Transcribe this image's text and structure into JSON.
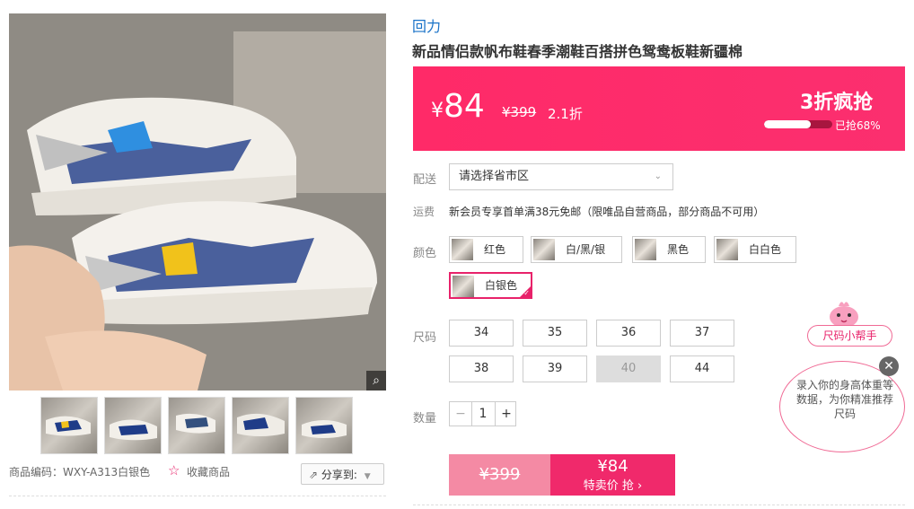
{
  "gallery": {
    "zoom_icon": "zoom-icon",
    "thumbnails": [
      {
        "alt": "thumbnail-1"
      },
      {
        "alt": "thumbnail-2"
      },
      {
        "alt": "thumbnail-3"
      },
      {
        "alt": "thumbnail-4"
      },
      {
        "alt": "thumbnail-5"
      }
    ],
    "sku_label": "商品编码：WXY-A313白银色",
    "favorite_label": "收藏商品",
    "share_label": "分享到:"
  },
  "product": {
    "brand": "回力",
    "title": "新品情侣款帆布鞋春季潮鞋百搭拼色鸳鸯板鞋新疆棉"
  },
  "price": {
    "currency": "¥",
    "now": "84",
    "original": "¥399",
    "discount": "2.1折",
    "promo": "3折疯抢",
    "sold_text": "已抢68%",
    "sold_fraction": 0.68,
    "accent": "#ff2a68"
  },
  "delivery": {
    "label": "配送",
    "select_value": "请选择省市区"
  },
  "shipping": {
    "label": "运费",
    "text": "新会员专享首单满38元免邮（限唯品自营商品，部分商品不可用）"
  },
  "colors": {
    "label": "颜色",
    "options": [
      "红色",
      "白/黑/银",
      "黑色",
      "白白色",
      "白银色"
    ],
    "selected": "白银色"
  },
  "sizes": {
    "label": "尺码",
    "options": [
      "34",
      "35",
      "36",
      "37",
      "38",
      "39",
      "40",
      "44"
    ],
    "disabled": [
      "40"
    ]
  },
  "quantity": {
    "label": "数量",
    "value": "1",
    "minus": "−",
    "plus": "+"
  },
  "buy": {
    "old_price": "¥399",
    "price": "¥84",
    "cta": "特卖价 抢 ›"
  },
  "helper": {
    "title": "尺码小帮手",
    "text": "录入你的身高体重等数据，为你精准推荐尺码",
    "close_icon": "close-icon"
  }
}
